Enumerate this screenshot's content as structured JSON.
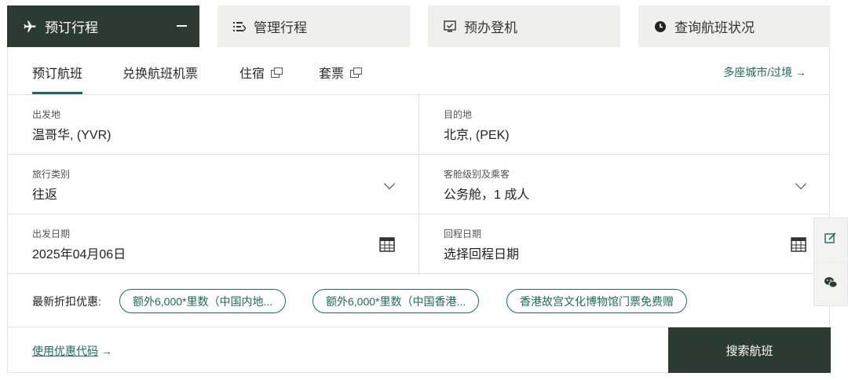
{
  "top_tabs": {
    "book": "预订行程",
    "manage": "管理行程",
    "checkin": "预办登机",
    "status": "查询航班状况"
  },
  "sub_tabs": {
    "book_flight": "预订航班",
    "redeem": "兑换航班机票",
    "hotel": "住宿",
    "package": "套票",
    "multi_city": "多座城市/过境 →"
  },
  "form": {
    "origin_label": "出发地",
    "origin_value": "温哥华, (YVR)",
    "destination_label": "目的地",
    "destination_value": "北京, (PEK)",
    "trip_type_label": "旅行类别",
    "trip_type_value": "往返",
    "cabin_label": "客舱级别及乘客",
    "cabin_value": "公务舱，1 成人",
    "depart_label": "出发日期",
    "depart_value": "2025年04月06日",
    "return_label": "回程日期",
    "return_value": "选择回程日期"
  },
  "promos": {
    "label": "最新折扣优惠:",
    "items": [
      "额外6,000*里数（中国内地...",
      "额外6,000*里数（中国香港...",
      "香港故宫文化博物馆门票免费赠"
    ]
  },
  "promo_code": "使用优惠代码",
  "promo_code_arrow": "→",
  "search_button": "搜索航班",
  "colors": {
    "dark": "#2b3a33",
    "accent": "#1f6a5e",
    "tab_bg": "#efefee"
  },
  "icons": {
    "book": "plane-icon",
    "manage": "list-icon",
    "checkin": "checkin-icon",
    "status": "clock-icon",
    "feedback": "edit-icon",
    "chat": "wechat-icon"
  }
}
